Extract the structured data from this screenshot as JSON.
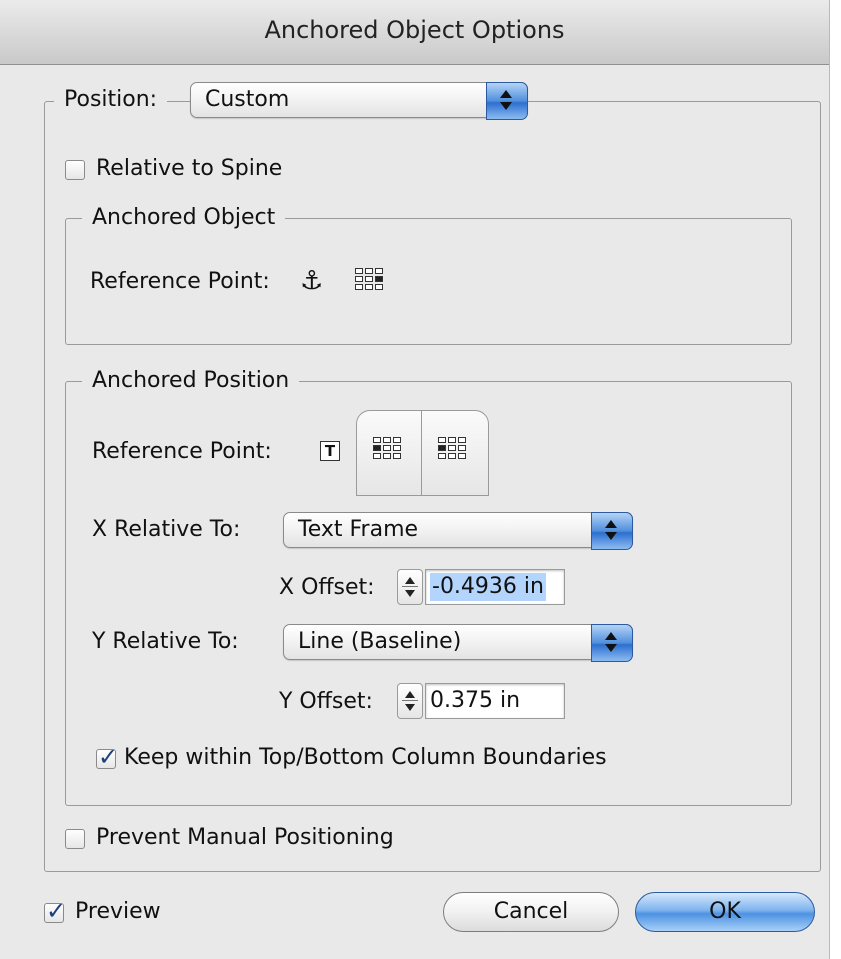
{
  "window": {
    "title": "Anchored Object Options"
  },
  "position": {
    "label": "Position:",
    "value": "Custom"
  },
  "relative_to_spine": {
    "label": "Relative to Spine",
    "checked": false
  },
  "anchored_object": {
    "legend": "Anchored Object",
    "reference_point_label": "Reference Point:",
    "anchor_icon": "anchor-icon",
    "grid_icon": "reference-point-grid-icon"
  },
  "anchored_position": {
    "legend": "Anchored Position",
    "reference_point_label": "Reference Point:",
    "text_frame_icon": "text-frame-icon",
    "x_relative_label": "X Relative To:",
    "x_relative_value": "Text Frame",
    "x_offset_label": "X Offset:",
    "x_offset_value": "-0.4936 in",
    "y_relative_label": "Y Relative To:",
    "y_relative_value": "Line (Baseline)",
    "y_offset_label": "Y Offset:",
    "y_offset_value": "0.375 in",
    "keep_within_label": "Keep within Top/Bottom Column Boundaries",
    "keep_within_checked": true
  },
  "prevent_manual": {
    "label": "Prevent Manual Positioning",
    "checked": false
  },
  "preview": {
    "label": "Preview",
    "checked": true
  },
  "buttons": {
    "cancel": "Cancel",
    "ok": "OK"
  },
  "colors": {
    "accent": "#4f8fdc",
    "selection": "#b3d4fc",
    "dialog_bg": "#e9e9e9"
  }
}
